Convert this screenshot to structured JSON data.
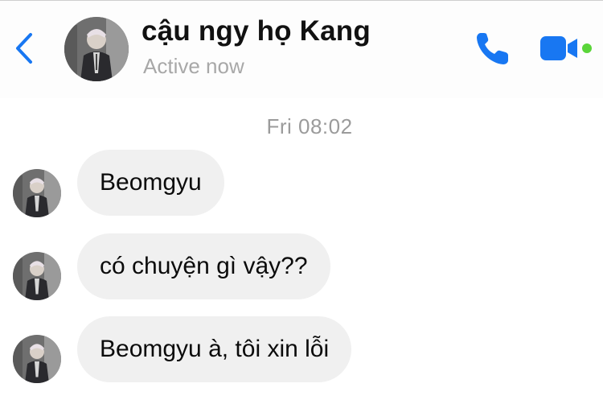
{
  "header": {
    "contact_name": "cậu ngy họ Kang",
    "status": "Active now",
    "accent_color": "#1877f2",
    "online_dot_color": "#5ad539"
  },
  "conversation": {
    "timestamp": "Fri 08:02",
    "messages": [
      {
        "text": "Beomgyu",
        "direction": "incoming"
      },
      {
        "text": "có chuyện gì vậy??",
        "direction": "incoming"
      },
      {
        "text": "Beomgyu à, tôi xin lỗi",
        "direction": "incoming"
      }
    ]
  },
  "icons": {
    "back": "chevron-left-icon",
    "call": "phone-icon",
    "video": "video-camera-icon"
  }
}
